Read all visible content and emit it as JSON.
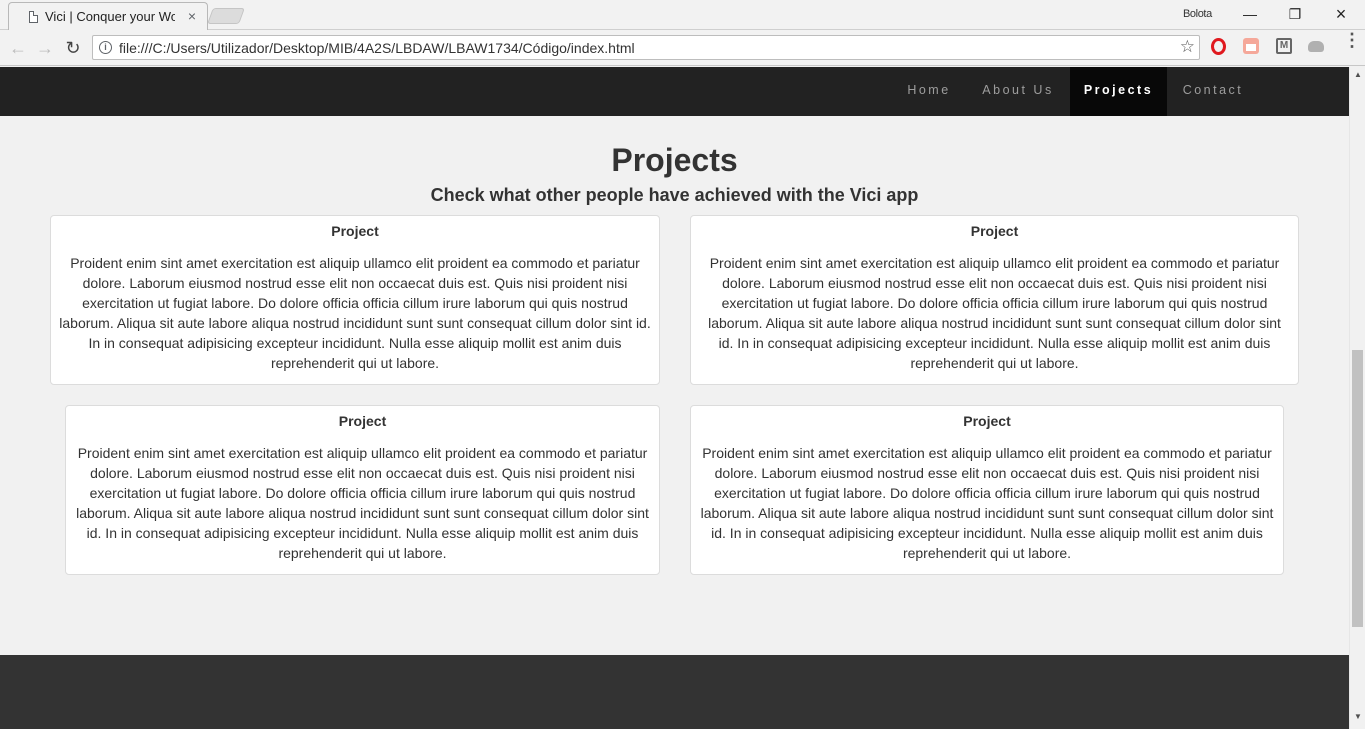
{
  "browser": {
    "tab": {
      "title": "Vici | Conquer your World",
      "close": "×"
    },
    "profile_name": "Bolota",
    "window_controls": {
      "minimize": "—",
      "restore": "❐",
      "close": "×"
    },
    "nav": {
      "back": "←",
      "forward": "→",
      "reload": "↻"
    },
    "url": "file:///C:/Users/Utilizador/Desktop/MIB/4A2S/LBDAW/LBAW1734/Código/index.html",
    "info_icon": "i",
    "bookmark_icon": "☆",
    "extensions": [
      "opera-icon",
      "extension-icon",
      "m-extension-icon",
      "cloud-icon"
    ],
    "menu": "⋮"
  },
  "site": {
    "nav": {
      "items": [
        {
          "label": "Home",
          "active": false
        },
        {
          "label": "About Us",
          "active": false
        },
        {
          "label": "Projects",
          "active": true
        },
        {
          "label": "Contact",
          "active": false
        }
      ]
    },
    "section": {
      "title": "Projects",
      "subtitle": "Check what other people have achieved with the Vici app"
    },
    "projects": [
      {
        "title": "Project",
        "text": "Proident enim sint amet exercitation est aliquip ullamco elit proident ea commodo et pariatur dolore. Laborum eiusmod nostrud esse elit non occaecat duis est. Quis nisi proident nisi exercitation ut fugiat labore. Do dolore officia officia cillum irure laborum qui quis nostrud laborum. Aliqua sit aute labore aliqua nostrud incididunt sunt sunt consequat cillum dolor sint id. In in consequat adipisicing excepteur incididunt. Nulla esse aliquip mollit est anim duis reprehenderit qui ut labore."
      },
      {
        "title": "Project",
        "text": "Proident enim sint amet exercitation est aliquip ullamco elit proident ea commodo et pariatur dolore. Laborum eiusmod nostrud esse elit non occaecat duis est. Quis nisi proident nisi exercitation ut fugiat labore. Do dolore officia officia cillum irure laborum qui quis nostrud laborum. Aliqua sit aute labore aliqua nostrud incididunt sunt sunt consequat cillum dolor sint id. In in consequat adipisicing excepteur incididunt. Nulla esse aliquip mollit est anim duis reprehenderit qui ut labore."
      },
      {
        "title": "Project",
        "text": "Proident enim sint amet exercitation est aliquip ullamco elit proident ea commodo et pariatur dolore. Laborum eiusmod nostrud esse elit non occaecat duis est. Quis nisi proident nisi exercitation ut fugiat labore. Do dolore officia officia cillum irure laborum qui quis nostrud laborum. Aliqua sit aute labore aliqua nostrud incididunt sunt sunt consequat cillum dolor sint id. In in consequat adipisicing excepteur incididunt. Nulla esse aliquip mollit est anim duis reprehenderit qui ut labore."
      },
      {
        "title": "Project",
        "text": "Proident enim sint amet exercitation est aliquip ullamco elit proident ea commodo et pariatur dolore. Laborum eiusmod nostrud esse elit non occaecat duis est. Quis nisi proident nisi exercitation ut fugiat labore. Do dolore officia officia cillum irure laborum qui quis nostrud laborum. Aliqua sit aute labore aliqua nostrud incididunt sunt sunt consequat cillum dolor sint id. In in consequat adipisicing excepteur incididunt. Nulla esse aliquip mollit est anim duis reprehenderit qui ut labore."
      }
    ]
  },
  "colors": {
    "navbar_bg": "#222222",
    "navbar_active_bg": "#080808",
    "page_bg": "#f1f1f1",
    "footer_bg": "#333333"
  }
}
